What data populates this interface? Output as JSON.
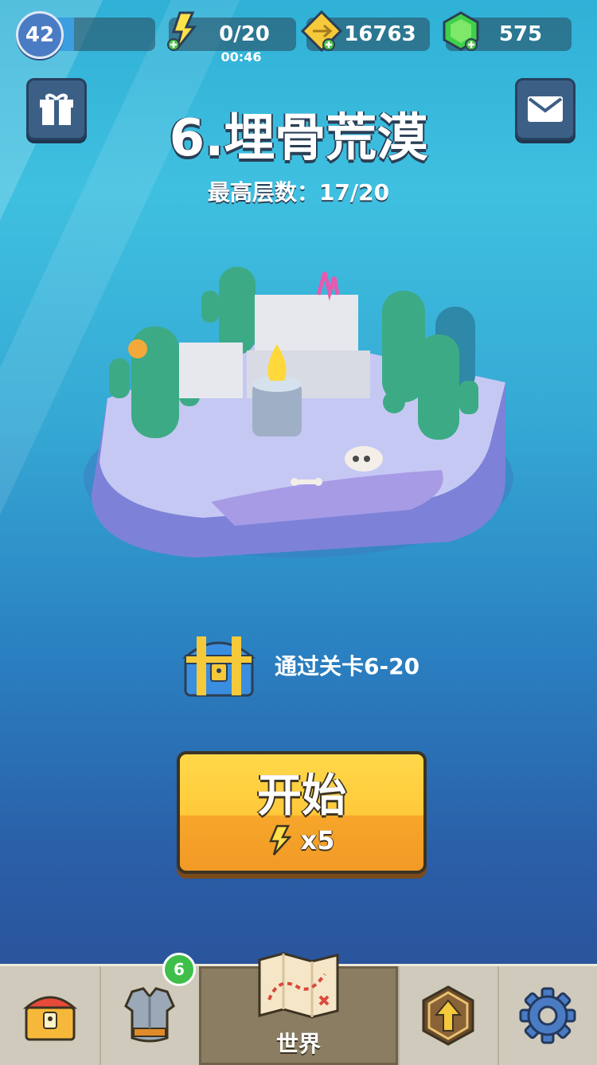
{
  "player": {
    "level": "42",
    "xp_fraction": 0.27
  },
  "resources": {
    "energy": "0/20",
    "energy_timer": "00:46",
    "gold": "16763",
    "gems": "575"
  },
  "stage": {
    "title": "6.埋骨荒漠",
    "best_floor": "最高层数：17/20"
  },
  "reward": {
    "text": "通过关卡6-20"
  },
  "start_button": {
    "label": "开始",
    "cost": "x5"
  },
  "nav": {
    "items": [
      {
        "icon": "chest-icon",
        "label": ""
      },
      {
        "icon": "armor-icon",
        "label": "",
        "badge": "6"
      },
      {
        "icon": "map-icon",
        "label": "世界"
      },
      {
        "icon": "upgrade-icon",
        "label": ""
      },
      {
        "icon": "gear-icon",
        "label": ""
      }
    ]
  },
  "colors": {
    "accent": "#f6a62a",
    "gem": "#3fd04a",
    "badge": "#3fbf4a"
  }
}
